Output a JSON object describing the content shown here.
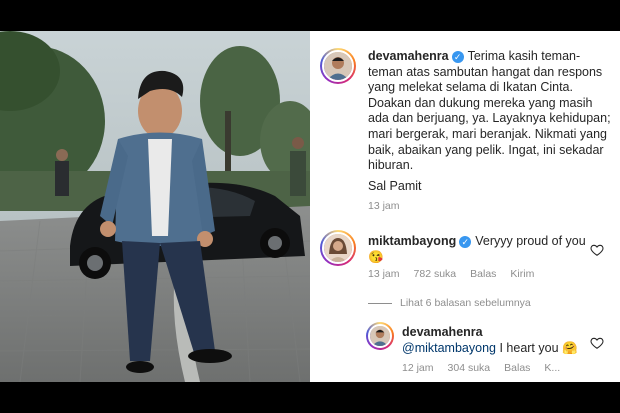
{
  "post": {
    "username": "devamahenra",
    "caption": "Terima kasih teman-teman atas sambutan hangat dan respons yang melekat selama di Ikatan Cinta. Doakan dan dukung mereka yang masih ada dan berjuang, ya. Layaknya kehidupan; mari bergerak, mari beranjak. Nikmati yang baik, abaikan yang pelik. Ingat, ini sekadar hiburan.",
    "signoff": "Sal Pamit",
    "time": "13 jam"
  },
  "comment1": {
    "username": "miktambayong",
    "text": "Veryyy proud of you",
    "emoji": "😘",
    "time": "13 jam",
    "likes": "782 suka",
    "reply": "Balas",
    "send": "Kirim"
  },
  "view_replies": "Lihat 6 balasan sebelumnya",
  "reply1": {
    "username": "devamahenra",
    "mention": "@miktambayong",
    "text": "I heart you",
    "emoji": "🤗",
    "time": "12 jam",
    "likes": "304 suka",
    "reply": "Balas",
    "more": "K..."
  },
  "colors": {
    "verified": "#3897f0",
    "mention": "#00376b",
    "secondary_text": "#8e8e8e"
  },
  "icons": [
    "verified-badge-icon",
    "heart-icon"
  ]
}
